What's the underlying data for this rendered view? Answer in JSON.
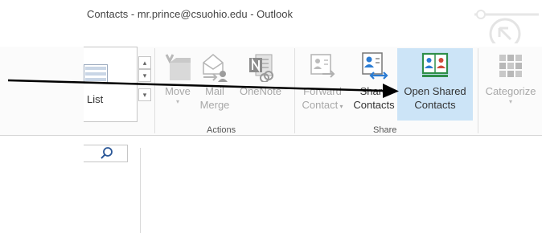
{
  "window": {
    "title": "Contacts - mr.prince@csuohio.edu - Outlook"
  },
  "ribbon": {
    "view_gallery": {
      "selected": "List"
    },
    "actions": {
      "label": "Actions",
      "move": "Move",
      "mail_merge": [
        "Mail",
        "Merge"
      ],
      "onenote": "OneNote"
    },
    "share": {
      "label": "Share",
      "forward_contact": [
        "Forward",
        "Contact"
      ],
      "share_contacts": [
        "Share",
        "Contacts"
      ],
      "open_shared_contacts": [
        "Open Shared",
        "Contacts"
      ]
    },
    "tags": {
      "categorize": "Categorize"
    }
  },
  "icons": [
    "list-icon",
    "search-icon",
    "move-icon",
    "mail-merge-icon",
    "onenote-icon",
    "forward-contact-icon",
    "share-contacts-icon",
    "open-shared-contacts-icon",
    "categorize-icon",
    "help-icon"
  ],
  "colors": {
    "selected": "#cce4f7",
    "disabled_text": "#a8a8a8",
    "accent": "#2b7cd3"
  }
}
